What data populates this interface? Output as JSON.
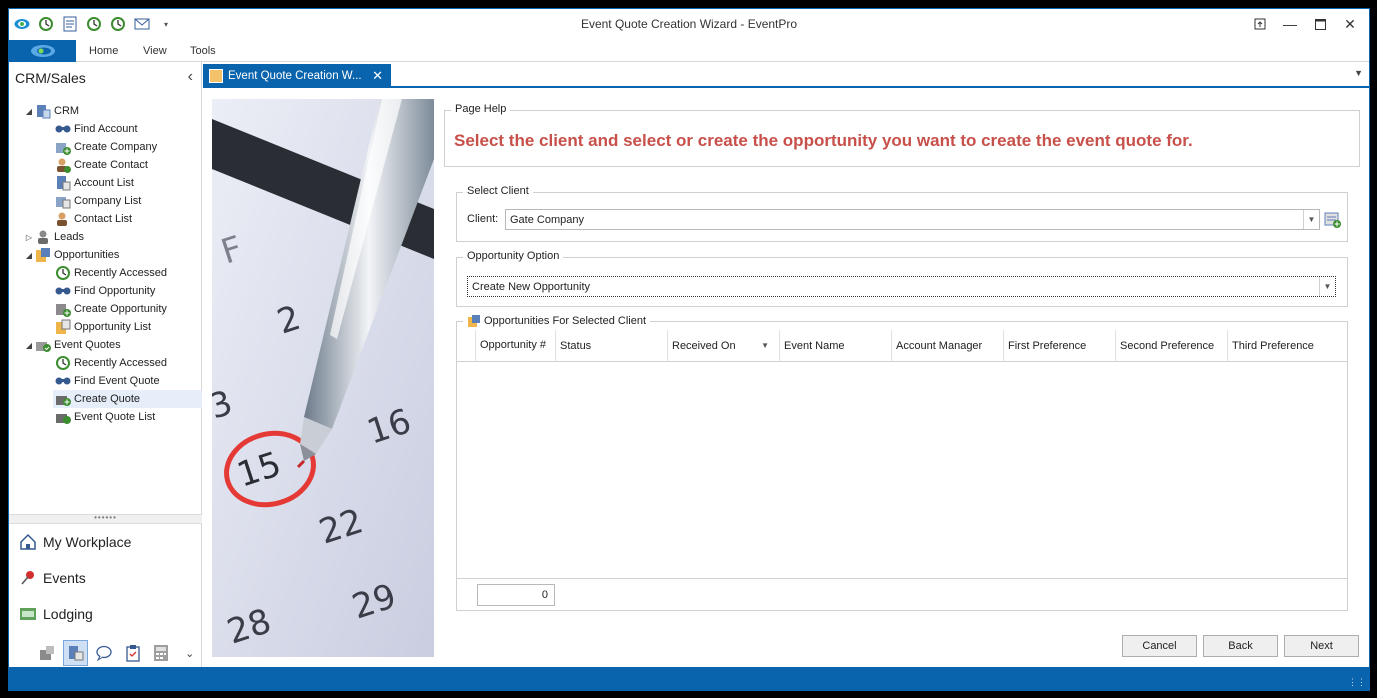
{
  "window": {
    "title": "Event Quote Creation Wizard - EventPro"
  },
  "quick_access": [
    {
      "icon": "eventpro-logo-icon"
    },
    {
      "icon": "recent-icon"
    },
    {
      "icon": "document-icon"
    },
    {
      "icon": "recent-icon"
    },
    {
      "icon": "recent-icon"
    },
    {
      "icon": "mail-icon"
    },
    {
      "icon": "customize-arrow-icon"
    }
  ],
  "ribbon": {
    "tabs": [
      "Home",
      "View",
      "Tools"
    ]
  },
  "nav": {
    "header": "CRM/Sales",
    "tree": [
      {
        "label": "CRM",
        "level": 0,
        "expanded": true,
        "icon": "crm-icon"
      },
      {
        "label": "Find Account",
        "level": 1,
        "icon": "binoculars-icon"
      },
      {
        "label": "Create Company",
        "level": 1,
        "icon": "create-company-icon"
      },
      {
        "label": "Create Contact",
        "level": 1,
        "icon": "create-contact-icon"
      },
      {
        "label": "Account List",
        "level": 1,
        "icon": "account-list-icon"
      },
      {
        "label": "Company List",
        "level": 1,
        "icon": "company-list-icon"
      },
      {
        "label": "Contact List",
        "level": 1,
        "icon": "contact-list-icon"
      },
      {
        "label": "Leads",
        "level": 0,
        "expanded": false,
        "icon": "leads-icon"
      },
      {
        "label": "Opportunities",
        "level": 0,
        "expanded": true,
        "icon": "opportunities-icon"
      },
      {
        "label": "Recently Accessed",
        "level": 1,
        "icon": "recent-icon"
      },
      {
        "label": "Find Opportunity",
        "level": 1,
        "icon": "binoculars-icon"
      },
      {
        "label": "Create Opportunity",
        "level": 1,
        "icon": "create-opportunity-icon"
      },
      {
        "label": "Opportunity List",
        "level": 1,
        "icon": "opportunity-list-icon"
      },
      {
        "label": "Event Quotes",
        "level": 0,
        "expanded": true,
        "icon": "event-quotes-icon"
      },
      {
        "label": "Recently Accessed",
        "level": 1,
        "icon": "recent-icon"
      },
      {
        "label": "Find Event Quote",
        "level": 1,
        "icon": "binoculars-icon"
      },
      {
        "label": "Create Quote",
        "level": 1,
        "icon": "create-quote-icon",
        "selected": true
      },
      {
        "label": "Event Quote List",
        "level": 1,
        "icon": "event-quote-list-icon"
      }
    ],
    "sections": [
      {
        "label": "My Workplace",
        "icon": "home-icon"
      },
      {
        "label": "Events",
        "icon": "pin-icon"
      },
      {
        "label": "Lodging",
        "icon": "lodging-icon"
      }
    ],
    "bottom_icons": [
      "inventory-icon",
      "crm-sales-icon",
      "chat-icon",
      "clipboard-icon",
      "calculator-icon",
      "chevron-down-icon"
    ]
  },
  "doc_tab": {
    "label": "Event Quote Creation W..."
  },
  "page_help": {
    "group_label": "Page Help",
    "text": "Select the client and select or create the opportunity you want to create the event quote for."
  },
  "select_client": {
    "group_label": "Select Client",
    "label": "Client:",
    "value": "Gate Company"
  },
  "opportunity_option": {
    "group_label": "Opportunity Option",
    "value": "Create New Opportunity"
  },
  "opportunities": {
    "group_label": "Opportunities For Selected Client",
    "columns": [
      "Opportunity #",
      "Status",
      "Received On",
      "Event Name",
      "Account Manager",
      "First Preference",
      "Second Preference",
      "Third Preference"
    ],
    "sorted_column": "Received On",
    "rows": [],
    "count": "0"
  },
  "buttons": {
    "cancel": "Cancel",
    "back": "Back",
    "next": "Next"
  },
  "colors": {
    "accent": "#0a64ad",
    "help_text": "#c8504a"
  }
}
